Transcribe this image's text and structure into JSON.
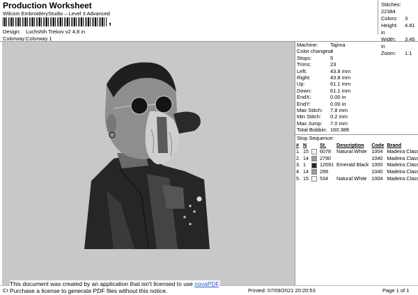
{
  "header": {
    "title": "Production Worksheet",
    "subtitle": "Wilcom EmbroideryStudio – Level 3 Advanced",
    "barcode_mark": ",",
    "design_label": "Design:",
    "design_value": "Luchshih Trekov v2 4,8 in",
    "colorway_label": "Colorway:",
    "colorway_value": "Colorway 1"
  },
  "summary": [
    {
      "label": "Stitches:",
      "value": "22384"
    },
    {
      "label": "Colors:",
      "value": "3"
    },
    {
      "label": "Height:",
      "value": "4.81 in"
    },
    {
      "label": "Width:",
      "value": "3.45 in"
    },
    {
      "label": "Zoom:",
      "value": "1:1"
    }
  ],
  "machine_info": [
    {
      "label": "Machine:",
      "value": "Tajima"
    },
    {
      "label": "Color changes:",
      "value": "4"
    },
    {
      "label": "Stops:",
      "value": "5"
    },
    {
      "label": "Trims:",
      "value": "23"
    },
    {
      "label": "Left:",
      "value": "43.8 mm"
    },
    {
      "label": "Right:",
      "value": "43.8 mm"
    },
    {
      "label": "Up:",
      "value": "61.1 mm"
    },
    {
      "label": "Down:",
      "value": "61.1 mm"
    },
    {
      "label": "EndX:",
      "value": "0.00 in"
    },
    {
      "label": "EndY:",
      "value": "0.00 in"
    },
    {
      "label": "Max Stitch:",
      "value": "7.8 mm"
    },
    {
      "label": "Min Stitch:",
      "value": "0.2 mm"
    },
    {
      "label": "Max Jump:",
      "value": "7.0 mm"
    },
    {
      "label": "Total Bobbin:",
      "value": "160.38ft"
    }
  ],
  "stop_sequence": {
    "title": "Stop Sequence:",
    "headers": [
      "#",
      "N",
      "St.",
      "Description",
      "Code",
      "Brand"
    ],
    "rows": [
      {
        "num": "1.",
        "n": "15",
        "color": "#f4f4f0",
        "st": "6078",
        "desc": "Natural White",
        "code": "1004",
        "brand": "Madeira Classic 40"
      },
      {
        "num": "2.",
        "n": "14",
        "color": "#9a9a9a",
        "st": "2790",
        "desc": "",
        "code": "1040",
        "brand": "Madeira Classic 40"
      },
      {
        "num": "3.",
        "n": "1",
        "color": "#1a2a22",
        "st": "12691",
        "desc": "Emerald Black",
        "code": "1000",
        "brand": "Madeira Classic 40"
      },
      {
        "num": "4.",
        "n": "14",
        "color": "#9a9a9a",
        "st": "289",
        "desc": "",
        "code": "1040",
        "brand": "Madeira Classic 40"
      },
      {
        "num": "5.",
        "n": "15",
        "color": "#f4f4f0",
        "st": "534",
        "desc": "Natural White",
        "code": "1004",
        "brand": "Madeira Classic 40"
      }
    ]
  },
  "footer": {
    "left": "Cr",
    "printed": "Printed: 07/09/2021 20:20:53",
    "page": "Page 1 of 1"
  },
  "notice": {
    "line1": "This document was created by an application that isn't licensed to use ",
    "link": "novaPDF",
    "line1_end": ".",
    "line2": "Purchase a license to generate PDF files without this notice."
  }
}
